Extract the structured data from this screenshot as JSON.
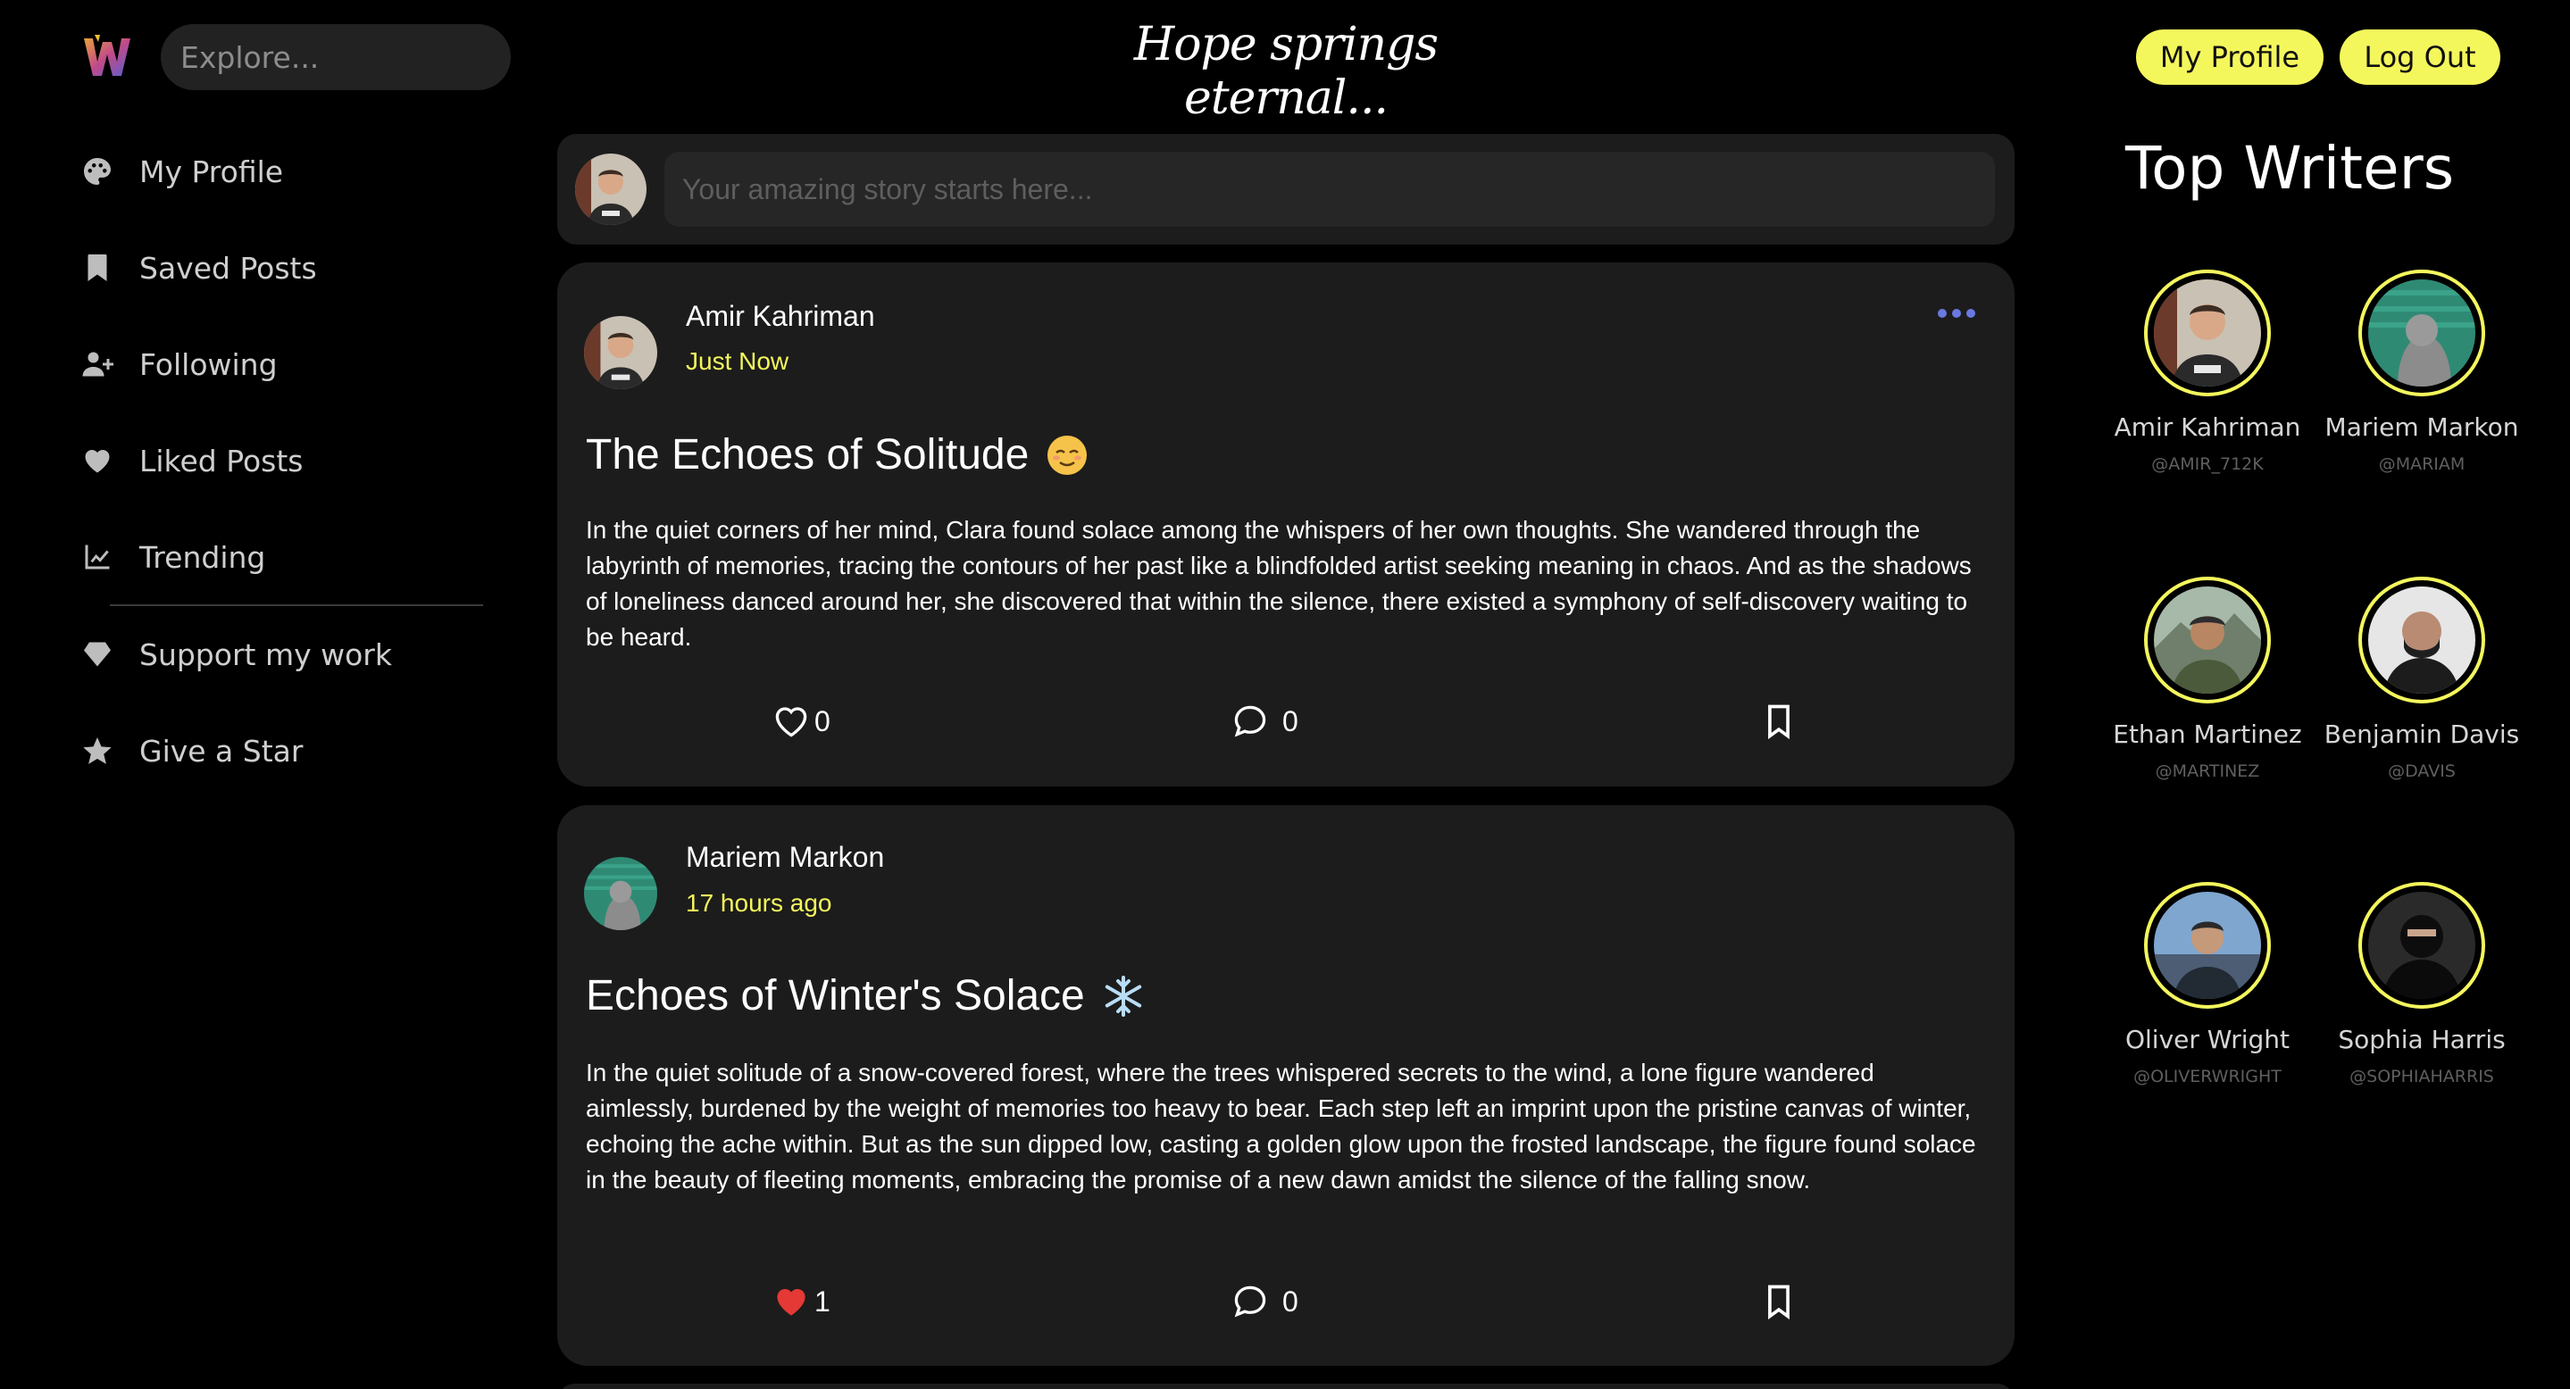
{
  "header": {
    "search_placeholder": "Explore...",
    "tagline": "Hope springs eternal...",
    "my_profile_label": "My Profile",
    "logout_label": "Log Out",
    "accent_color": "#f4f75c"
  },
  "sidebar": {
    "items": [
      {
        "label": "My Profile",
        "icon": "palette-icon"
      },
      {
        "label": "Saved Posts",
        "icon": "bookmark-icon"
      },
      {
        "label": "Following",
        "icon": "user-plus-icon"
      },
      {
        "label": "Liked Posts",
        "icon": "heart-icon"
      },
      {
        "label": "Trending",
        "icon": "chart-line-icon"
      },
      {
        "label": "Support my work",
        "icon": "gem-icon"
      },
      {
        "label": "Give a Star",
        "icon": "star-icon"
      }
    ]
  },
  "composer": {
    "placeholder": "Your amazing story starts here..."
  },
  "posts": [
    {
      "author": "Amir Kahriman",
      "time": "Just Now",
      "title": "The Echoes of Solitude",
      "emoji": "relieved-face-emoji",
      "body": "In the quiet corners of her mind, Clara found solace among the whispers of her own thoughts. She wandered through the labyrinth of memories, tracing the contours of her past like a blindfolded artist seeking meaning in chaos. And as the shadows of loneliness danced around her, she discovered that within the silence, there existed a symphony of self-discovery waiting to be heard.",
      "likes": "0",
      "comments": "0",
      "liked": false
    },
    {
      "author": "Mariem Markon",
      "time": "17 hours ago",
      "title": "Echoes of Winter's Solace",
      "emoji": "snowflake-emoji",
      "body": "In the quiet solitude of a snow-covered forest, where the trees whispered secrets to the wind, a lone figure wandered aimlessly, burdened by the weight of memories too heavy to bear. Each step left an imprint upon the pristine canvas of winter, echoing the ache within. But as the sun dipped low, casting a golden glow upon the frosted landscape, the figure found solace in the beauty of fleeting moments, embracing the promise of a new dawn amidst the silence of the falling snow.",
      "likes": "1",
      "comments": "0",
      "liked": true
    }
  ],
  "top_writers": {
    "title": "Top Writers",
    "writers": [
      {
        "name": "Amir Kahriman",
        "handle": "@AMIR_712K"
      },
      {
        "name": "Mariem Markon",
        "handle": "@MARIAM"
      },
      {
        "name": "Ethan Martinez",
        "handle": "@MARTINEZ"
      },
      {
        "name": "Benjamin Davis",
        "handle": "@DAVIS"
      },
      {
        "name": "Oliver Wright",
        "handle": "@OLIVERWRIGHT"
      },
      {
        "name": "Sophia Harris",
        "handle": "@SOPHIAHARRIS"
      }
    ]
  }
}
